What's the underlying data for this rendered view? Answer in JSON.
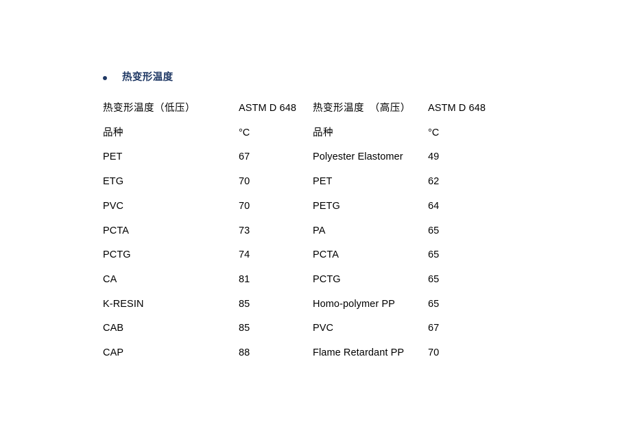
{
  "document": {
    "background_color": "#ffffff",
    "text_color": "#000000",
    "accent_color": "#1f3864"
  },
  "section": {
    "bullet_glyph": "•",
    "heading": "热变形温度"
  },
  "table": {
    "header_row_1": {
      "left_title": "热变形温度（低压）",
      "left_standard": "ASTM D 648",
      "right_title": "热变形温度　（高压）",
      "right_standard": "ASTM D 648"
    },
    "header_row_2": {
      "left_category": "品种",
      "left_unit": "°C",
      "right_category": "品种",
      "right_unit": "°C"
    },
    "rows": [
      {
        "left_name": "PET",
        "left_value": "67",
        "right_name": "Polyester Elastomer",
        "right_value": "49"
      },
      {
        "left_name": "ETG",
        "left_value": "70",
        "right_name": "PET",
        "right_value": "62"
      },
      {
        "left_name": "PVC",
        "left_value": "70",
        "right_name": "PETG",
        "right_value": "64"
      },
      {
        "left_name": "PCTA",
        "left_value": "73",
        "right_name": "PA",
        "right_value": "65"
      },
      {
        "left_name": "PCTG",
        "left_value": "74",
        "right_name": "PCTA",
        "right_value": "65"
      },
      {
        "left_name": "CA",
        "left_value": "81",
        "right_name": "PCTG",
        "right_value": "65"
      },
      {
        "left_name": "K-RESIN",
        "left_value": "85",
        "right_name": "Homo-polymer PP",
        "right_value": "65"
      },
      {
        "left_name": "CAB",
        "left_value": "85",
        "right_name": "PVC",
        "right_value": "67"
      },
      {
        "left_name": "CAP",
        "left_value": "88",
        "right_name": "Flame Retardant PP",
        "right_value": "70"
      }
    ]
  },
  "chart_data": {
    "type": "table",
    "title": "热变形温度",
    "ylabel": "°C",
    "series": [
      {
        "name": "热变形温度（低压） ASTM D 648",
        "categories": [
          "PET",
          "ETG",
          "PVC",
          "PCTA",
          "PCTG",
          "CA",
          "K-RESIN",
          "CAB",
          "CAP"
        ],
        "values": [
          67,
          70,
          70,
          73,
          74,
          81,
          85,
          85,
          88
        ]
      },
      {
        "name": "热变形温度　（高压） ASTM D 648",
        "categories": [
          "Polyester Elastomer",
          "PET",
          "PETG",
          "PA",
          "PCTA",
          "PCTG",
          "Homo-polymer PP",
          "PVC",
          "Flame Retardant PP"
        ],
        "values": [
          49,
          62,
          64,
          65,
          65,
          65,
          65,
          67,
          70
        ]
      }
    ]
  }
}
